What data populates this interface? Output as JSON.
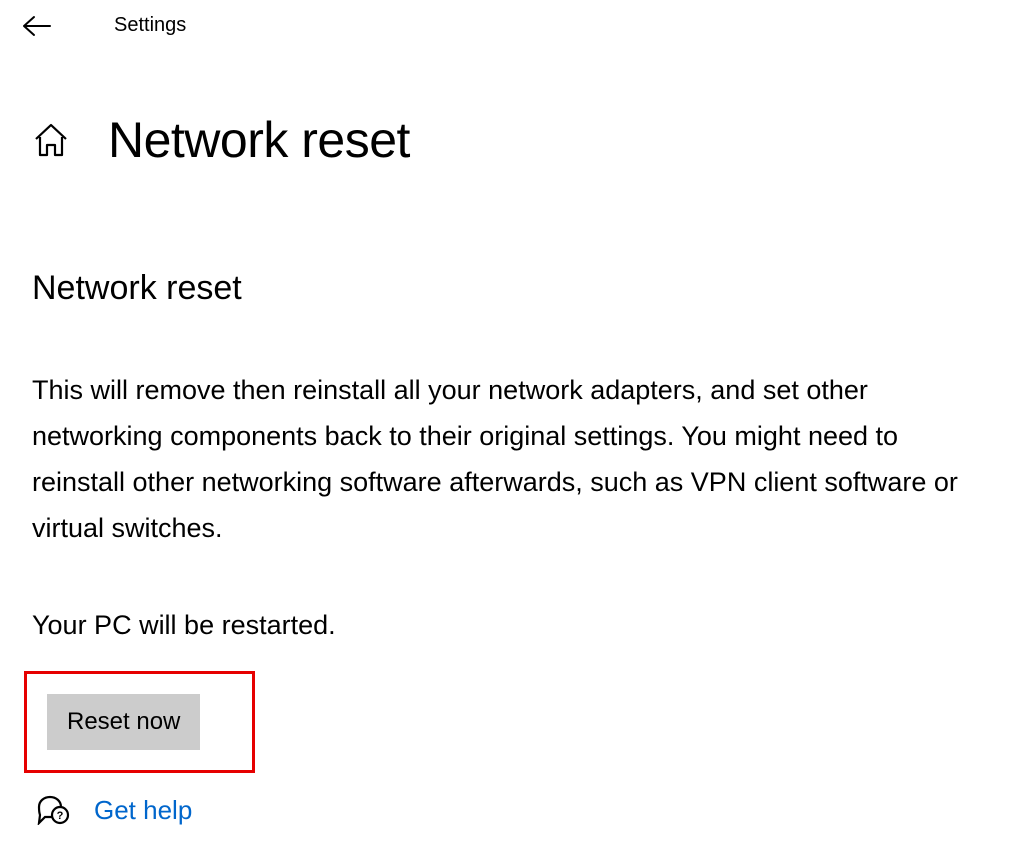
{
  "header": {
    "title": "Settings"
  },
  "page": {
    "title": "Network reset",
    "section_heading": "Network reset",
    "description": "This will remove then reinstall all your network adapters, and set other networking components back to their original settings. You might need to reinstall other networking software afterwards, such as VPN client software or virtual switches.",
    "restart_note": "Your PC will be restarted.",
    "reset_button": "Reset now",
    "help_link": "Get help"
  }
}
